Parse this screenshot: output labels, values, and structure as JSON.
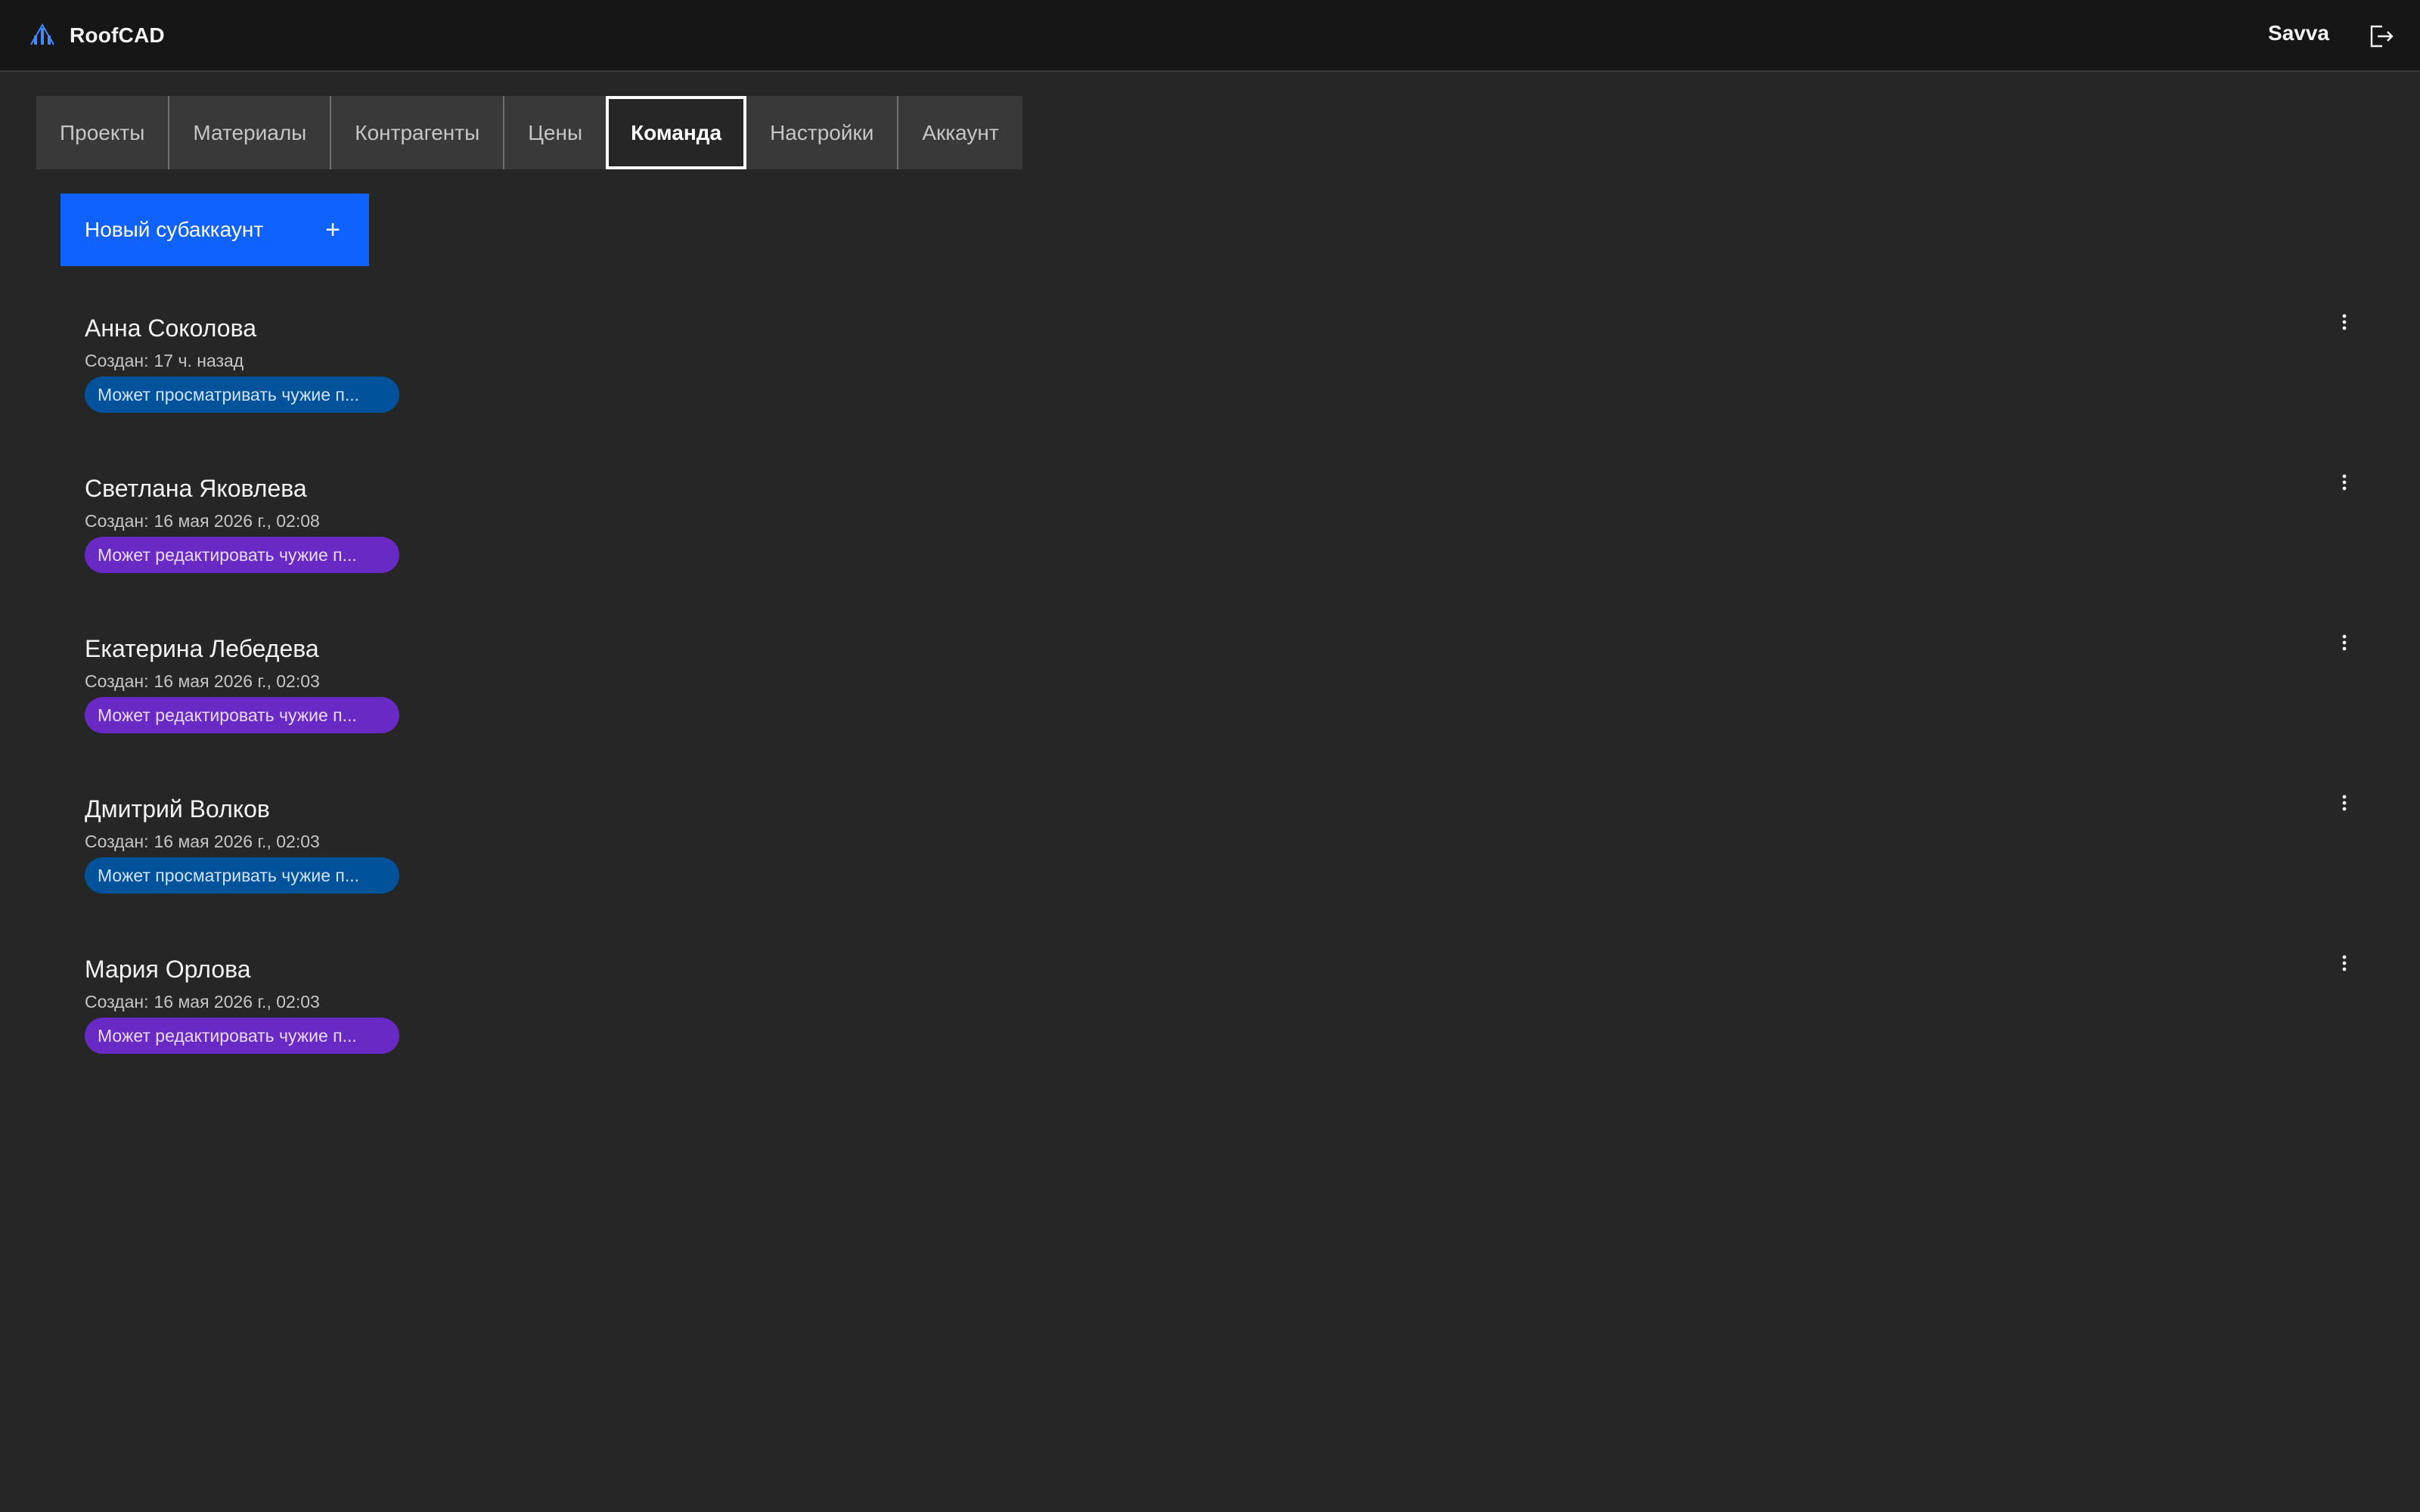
{
  "header": {
    "brand": "RoofCAD",
    "user": "Savva"
  },
  "tabs": [
    {
      "label": "Проекты"
    },
    {
      "label": "Материалы"
    },
    {
      "label": "Контрагенты"
    },
    {
      "label": "Цены"
    },
    {
      "label": "Команда",
      "active": true
    },
    {
      "label": "Настройки"
    },
    {
      "label": "Аккаунт"
    }
  ],
  "new_subaccount": {
    "label": "Новый субаккаунт",
    "icon": "+"
  },
  "members": [
    {
      "name": "Анна Соколова",
      "created_label": "Создан:",
      "created": "17 ч. назад",
      "permission": "Может просматривать чужие п...",
      "permission_type": "view"
    },
    {
      "name": "Светлана Яковлева",
      "created_label": "Создан:",
      "created": "16 мая 2026 г., 02:08",
      "permission": "Может редактировать чужие п...",
      "permission_type": "edit"
    },
    {
      "name": "Екатерина Лебедева",
      "created_label": "Создан:",
      "created": "16 мая 2026 г., 02:03",
      "permission": "Может редактировать чужие п...",
      "permission_type": "edit"
    },
    {
      "name": "Дмитрий Волков",
      "created_label": "Создан:",
      "created": "16 мая 2026 г., 02:03",
      "permission": "Может просматривать чужие п...",
      "permission_type": "view"
    },
    {
      "name": "Мария Орлова",
      "created_label": "Создан:",
      "created": "16 мая 2026 г., 02:03",
      "permission": "Может редактировать чужие п...",
      "permission_type": "edit"
    }
  ],
  "colors": {
    "background": "#262626",
    "header": "#161616",
    "primary_button": "#0f62fe",
    "badge_view": "#00539a",
    "badge_edit": "#6929c4"
  },
  "icons": {
    "logo": "roofcad-logo-icon",
    "logout": "logout-icon",
    "overflow": "overflow-menu-vertical-icon"
  }
}
